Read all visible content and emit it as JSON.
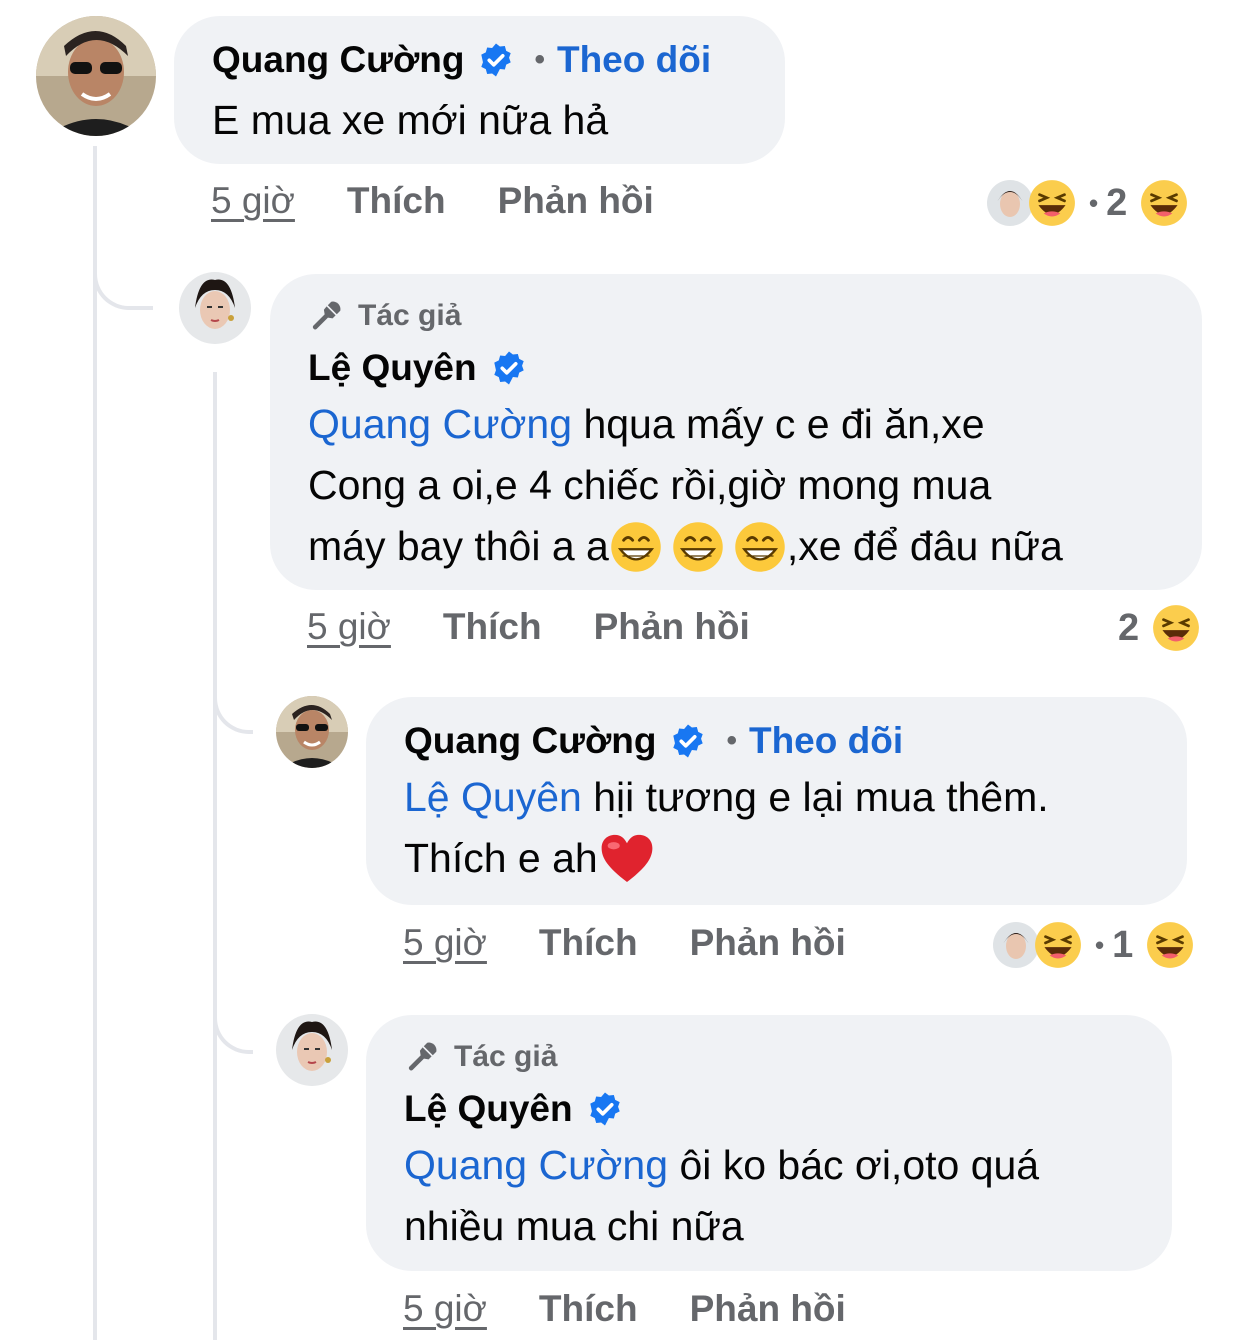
{
  "comments": [
    {
      "author": "Quang Cường",
      "follow_label": "Theo dõi",
      "text": "E mua xe mới nữa hả",
      "time": "5 giờ",
      "like": "Thích",
      "reply": "Phản hồi",
      "reaction_count": "2"
    },
    {
      "author_badge": "Tác giả",
      "author": "Lệ Quyên",
      "mention": "Quang Cường",
      "text_line1": " hqua mấy c e đi ăn,xe",
      "text_line2": "Cong a oi,e 4 chiếc rồi,giờ mong mua",
      "text_line3_start": "máy bay thôi a a",
      "text_line3_end": ",xe để đâu nữa",
      "time": "5 giờ",
      "like": "Thích",
      "reply": "Phản hồi",
      "reaction_count": "2"
    },
    {
      "author": "Quang Cường",
      "follow_label": "Theo dõi",
      "mention": "Lệ Quyên",
      "text_line1": " hịi tương e lại mua thêm.",
      "text_line2": "Thích e ah",
      "time": "5 giờ",
      "like": "Thích",
      "reply": "Phản hồi",
      "reaction_count": "1"
    },
    {
      "author_badge": "Tác giả",
      "author": "Lệ Quyên",
      "mention": "Quang Cường",
      "text_line1": " ôi ko bác ơi,oto quá",
      "text_line2": "nhiều mua chi nữa",
      "time": "5 giờ",
      "like": "Thích",
      "reply": "Phản hồi"
    }
  ],
  "colors": {
    "bubble": "#f0f2f5",
    "link": "#1b66d1",
    "muted": "#65676b",
    "verified": "#1877f2"
  },
  "icons": [
    "verified-badge-icon",
    "microphone-icon",
    "haha-reaction-icon",
    "grin-emoji-icon",
    "heart-emoji-icon"
  ]
}
